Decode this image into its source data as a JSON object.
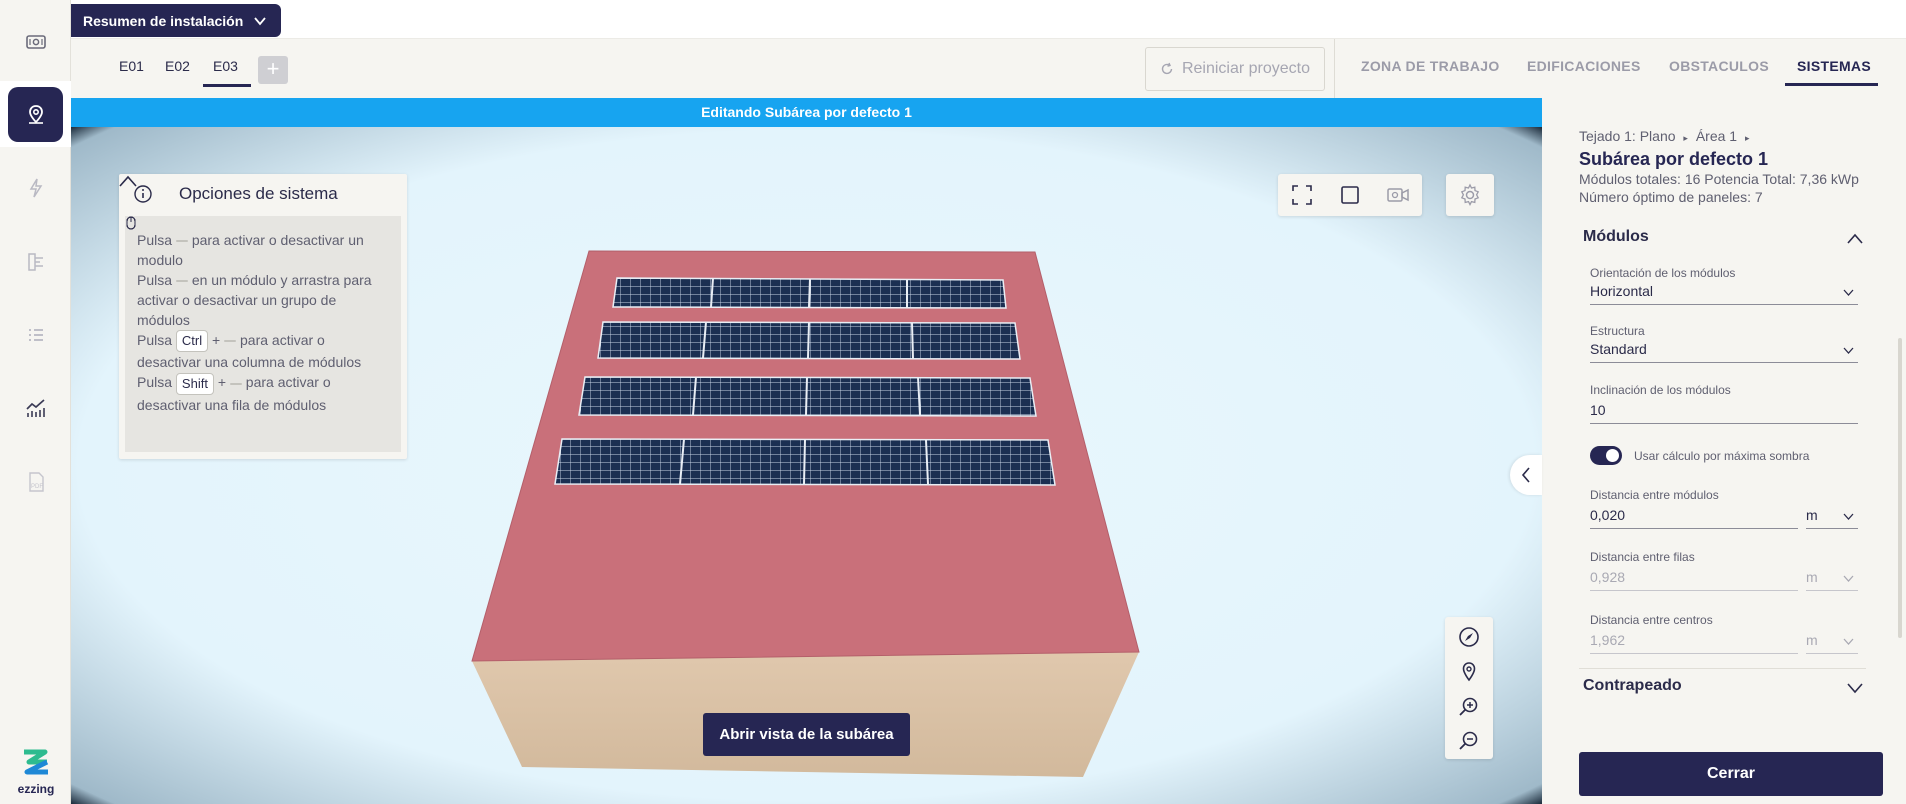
{
  "header": {
    "install_summary": "Resumen de instalación"
  },
  "edificaciones_tabs": [
    {
      "label": "E01"
    },
    {
      "label": "E02"
    },
    {
      "label": "E03"
    }
  ],
  "add_tab_label": "+",
  "restart_label": "Reiniciar proyecto",
  "main_tabs": [
    {
      "label": "ZONA DE TRABAJO"
    },
    {
      "label": "EDIFICACIONES"
    },
    {
      "label": "OBSTACULOS"
    },
    {
      "label": "SISTEMAS"
    }
  ],
  "active_main_tab": "SISTEMAS",
  "editing_banner": "Editando Subárea por defecto 1",
  "options_panel": {
    "title": "Opciones de sistema",
    "line1_a": "Pulsa",
    "line1_b": "para activar o desactivar un modulo",
    "line2_a": "Pulsa",
    "line2_b": "en un módulo y arrastra para activar o desactivar un grupo de módulos",
    "line3_a": "Pulsa",
    "key_ctrl": "Ctrl",
    "plus": "+",
    "line3_b": "para activar o desactivar una columna de módulos",
    "line4_a": "Pulsa",
    "key_shift": "Shift",
    "line4_b": "para activar o desactivar una fila de módulos"
  },
  "open_subarea_label": "Abrir vista de la subárea",
  "right_panel": {
    "breadcrumb_1": "Tejado 1: Plano",
    "breadcrumb_2": "Área 1",
    "title": "Subárea por defecto 1",
    "totals": "Módulos totales: 16 Potencia Total: 7,36 kWp",
    "optimal": "Número óptimo de paneles: 7",
    "modules_section": "Módulos",
    "orientation_label": "Orientación de los módulos",
    "orientation_value": "Horizontal",
    "structure_label": "Estructura",
    "structure_value": "Standard",
    "tilt_label": "Inclinación de los módulos",
    "tilt_value": "10",
    "shadow_toggle_label": "Usar cálculo por máxima sombra",
    "shadow_toggle_on": true,
    "module_distance_label": "Distancia entre módulos",
    "module_distance_value": "0,020",
    "module_distance_unit": "m",
    "row_distance_label": "Distancia entre filas",
    "row_distance_value": "0,928",
    "row_distance_unit": "m",
    "center_distance_label": "Distancia entre centros",
    "center_distance_value": "1,962",
    "center_distance_unit": "m",
    "plywood_section": "Contrapeado",
    "close_label": "Cerrar"
  },
  "logo_text": "ezzing",
  "colors": {
    "brand_navy": "#262653",
    "banner_blue": "#17a4f0",
    "roof_red": "#c9707a",
    "building_sand": "#d7c0a6",
    "panel_navy": "#1b2f52"
  }
}
